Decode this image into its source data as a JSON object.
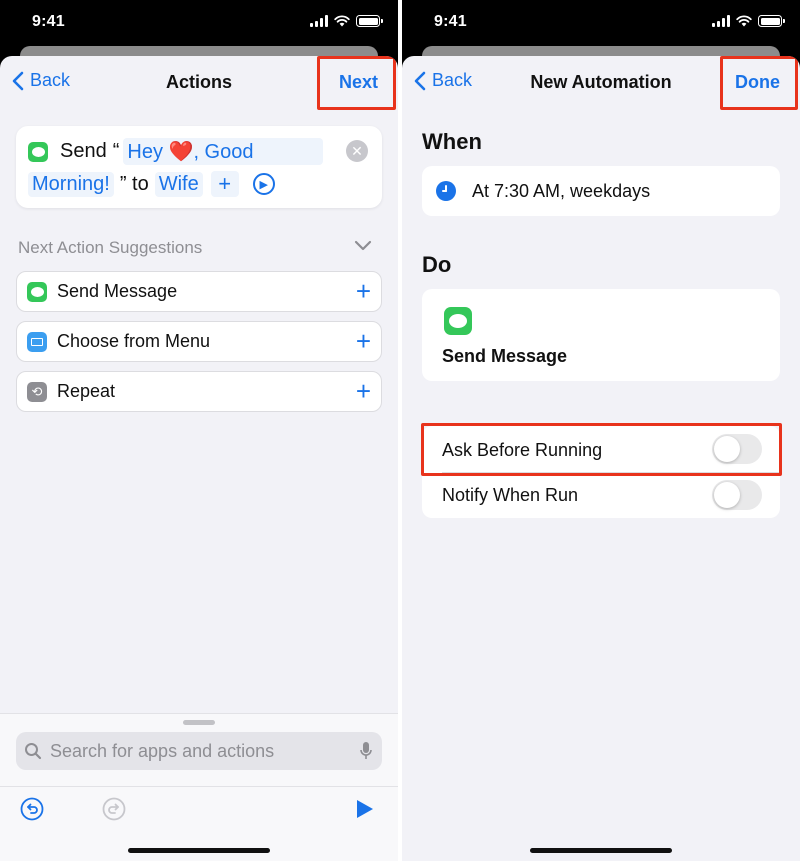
{
  "status_bar": {
    "time": "9:41"
  },
  "left": {
    "nav": {
      "back_label": "Back",
      "title": "Actions",
      "action_label": "Next"
    },
    "action": {
      "verb": "Send",
      "open_quote": "“",
      "message_part1": "Hey",
      "heart": "❤️",
      "message_part2": ", Good",
      "message_line2": "Morning!",
      "close_quote_to": "” to",
      "recipient": "Wife",
      "add_symbol": "+"
    },
    "suggestions": {
      "header": "Next Action Suggestions",
      "items": [
        {
          "label": "Send Message"
        },
        {
          "label": "Choose from Menu"
        },
        {
          "label": "Repeat"
        }
      ],
      "add_symbol": "+"
    },
    "search": {
      "placeholder": "Search for apps and actions"
    }
  },
  "right": {
    "nav": {
      "back_label": "Back",
      "title": "New Automation",
      "action_label": "Done"
    },
    "when": {
      "title": "When",
      "trigger": "At 7:30 AM, weekdays"
    },
    "do": {
      "title": "Do",
      "action": "Send Message"
    },
    "settings": {
      "ask_before_running": {
        "label": "Ask Before Running",
        "on": false
      },
      "notify_when_run": {
        "label": "Notify When Run",
        "on": false
      }
    }
  },
  "colors": {
    "accent": "#1a73e8",
    "highlight": "#e8331c",
    "messages_green": "#34c759"
  }
}
